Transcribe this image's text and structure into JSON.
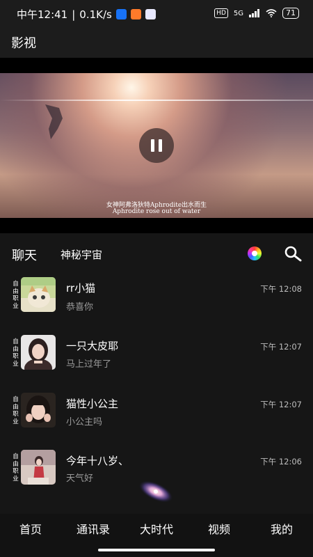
{
  "status_bar": {
    "time": "中午12:41",
    "separator": "|",
    "speed": "0.1K/s",
    "hd": "HD",
    "network": "5G",
    "battery": "71"
  },
  "header": {
    "title": "影视"
  },
  "video": {
    "subtitle_cn": "女神阿弗洛狄特Aphrodite出水而生",
    "subtitle_en": "Aphrodite rose out of water"
  },
  "tabs": {
    "chat": "聊天",
    "universe": "神秘宇宙"
  },
  "chats": [
    {
      "tag": "自由职业",
      "name": "rr小猫",
      "message": "恭喜你",
      "time": "下午 12:08"
    },
    {
      "tag": "自由职业",
      "name": "一只大皮耶",
      "message": "马上过年了",
      "time": "下午 12:07"
    },
    {
      "tag": "自由职业",
      "name": "猫性小公主",
      "message": "小公主吗",
      "time": "下午 12:07"
    },
    {
      "tag": "自由职业",
      "name": "今年十八岁、",
      "message": "天气好",
      "time": "下午 12:06"
    }
  ],
  "nav": [
    {
      "label": "首页"
    },
    {
      "label": "通讯录"
    },
    {
      "label": "大时代"
    },
    {
      "label": "视频"
    },
    {
      "label": "我的"
    }
  ],
  "icons": {
    "pause": "pause-icon",
    "colorful": "color-wheel-icon",
    "search": "search-icon",
    "galaxy": "galaxy-icon"
  }
}
